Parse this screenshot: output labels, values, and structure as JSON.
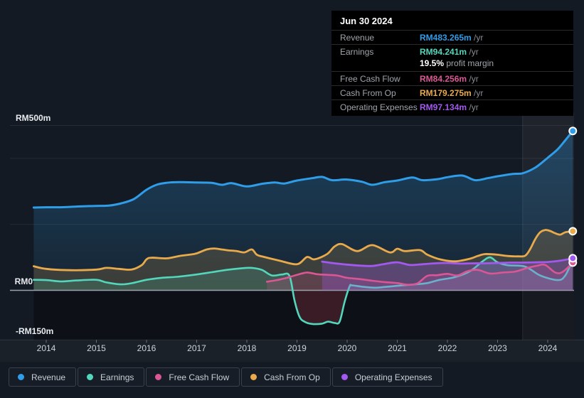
{
  "colors": {
    "background": "#141A23",
    "tooltip_background": "#000000",
    "revenue": "#2F9DE8",
    "earnings": "#52D7BC",
    "fcf": "#DB5694",
    "cashop": "#E9AA4C",
    "opex": "#A358F0",
    "negative_fill": "#D94560"
  },
  "tooltip": {
    "date": "Jun 30 2024",
    "rows": [
      {
        "key": "revenue",
        "label": "Revenue",
        "value": "RM483.265m",
        "suffix": " /yr"
      },
      {
        "key": "earnings",
        "label": "Earnings",
        "value": "RM94.241m",
        "suffix": " /yr",
        "sub_bold": "19.5%",
        "sub_text": " profit margin"
      },
      {
        "key": "fcf",
        "label": "Free Cash Flow",
        "value": "RM84.256m",
        "suffix": " /yr"
      },
      {
        "key": "cashop",
        "label": "Cash From Op",
        "value": "RM179.275m",
        "suffix": " /yr"
      },
      {
        "key": "opex",
        "label": "Operating Expenses",
        "value": "RM97.134m",
        "suffix": " /yr"
      }
    ]
  },
  "legend": {
    "items": [
      {
        "key": "revenue",
        "label": "Revenue"
      },
      {
        "key": "earnings",
        "label": "Earnings"
      },
      {
        "key": "fcf",
        "label": "Free Cash Flow"
      },
      {
        "key": "cashop",
        "label": "Cash From Op"
      },
      {
        "key": "opex",
        "label": "Operating Expenses"
      }
    ]
  },
  "chart_data": {
    "type": "area",
    "unit": "RM millions per year",
    "x_ticks": [
      2014,
      2015,
      2016,
      2017,
      2018,
      2019,
      2020,
      2021,
      2022,
      2023,
      2024
    ],
    "x_range": [
      2013.75,
      2024.5
    ],
    "y_axis": {
      "min": -150,
      "max": 500,
      "gridline_values": [
        500,
        400,
        200,
        0
      ],
      "labels": [
        {
          "text": "RM500m",
          "value": 500
        },
        {
          "text": "RM0",
          "value": 0
        },
        {
          "text": "-RM150m",
          "value": -150
        }
      ]
    },
    "highlight_band": {
      "from": 2023.5,
      "to": 2024.5
    },
    "series": [
      {
        "key": "revenue",
        "name": "Revenue",
        "points": [
          [
            2013.75,
            251
          ],
          [
            2014,
            252
          ],
          [
            2014.3,
            252
          ],
          [
            2014.6,
            254
          ],
          [
            2015,
            256
          ],
          [
            2015.25,
            257
          ],
          [
            2015.5,
            264
          ],
          [
            2015.75,
            277
          ],
          [
            2016,
            305
          ],
          [
            2016.2,
            320
          ],
          [
            2016.4,
            326
          ],
          [
            2016.65,
            328
          ],
          [
            2017,
            327
          ],
          [
            2017.3,
            326
          ],
          [
            2017.5,
            320
          ],
          [
            2017.7,
            325
          ],
          [
            2018,
            315
          ],
          [
            2018.3,
            323
          ],
          [
            2018.55,
            327
          ],
          [
            2018.75,
            324
          ],
          [
            2019,
            333
          ],
          [
            2019.3,
            340
          ],
          [
            2019.5,
            344
          ],
          [
            2019.7,
            334
          ],
          [
            2020,
            336
          ],
          [
            2020.3,
            329
          ],
          [
            2020.5,
            320
          ],
          [
            2020.75,
            328
          ],
          [
            2021,
            333
          ],
          [
            2021.3,
            342
          ],
          [
            2021.5,
            334
          ],
          [
            2021.8,
            337
          ],
          [
            2022,
            343
          ],
          [
            2022.3,
            348
          ],
          [
            2022.55,
            334
          ],
          [
            2022.8,
            340
          ],
          [
            2023,
            346
          ],
          [
            2023.3,
            353
          ],
          [
            2023.5,
            355
          ],
          [
            2023.75,
            372
          ],
          [
            2024,
            402
          ],
          [
            2024.2,
            428
          ],
          [
            2024.35,
            455
          ],
          [
            2024.5,
            483.265
          ]
        ]
      },
      {
        "key": "cashop",
        "name": "Cash From Op",
        "points": [
          [
            2013.75,
            73
          ],
          [
            2014,
            65
          ],
          [
            2014.5,
            61
          ],
          [
            2015,
            63
          ],
          [
            2015.2,
            68
          ],
          [
            2015.45,
            65
          ],
          [
            2015.7,
            63
          ],
          [
            2015.9,
            76
          ],
          [
            2016,
            94
          ],
          [
            2016.1,
            99
          ],
          [
            2016.4,
            97
          ],
          [
            2016.65,
            104
          ],
          [
            2016.85,
            108
          ],
          [
            2017,
            112
          ],
          [
            2017.2,
            124
          ],
          [
            2017.35,
            127
          ],
          [
            2017.5,
            124
          ],
          [
            2017.65,
            121
          ],
          [
            2017.8,
            119
          ],
          [
            2017.95,
            115
          ],
          [
            2018.1,
            124
          ],
          [
            2018.2,
            108
          ],
          [
            2018.35,
            101
          ],
          [
            2018.65,
            90
          ],
          [
            2019,
            79
          ],
          [
            2019.2,
            101
          ],
          [
            2019.35,
            94
          ],
          [
            2019.6,
            110
          ],
          [
            2019.75,
            133
          ],
          [
            2019.9,
            140
          ],
          [
            2020.2,
            119
          ],
          [
            2020.5,
            137
          ],
          [
            2020.85,
            115
          ],
          [
            2021,
            126
          ],
          [
            2021.15,
            119
          ],
          [
            2021.45,
            122
          ],
          [
            2021.6,
            108
          ],
          [
            2021.85,
            94
          ],
          [
            2022.15,
            88
          ],
          [
            2022.45,
            96
          ],
          [
            2022.6,
            104
          ],
          [
            2022.75,
            110
          ],
          [
            2023,
            108
          ],
          [
            2023.2,
            104
          ],
          [
            2023.4,
            103
          ],
          [
            2023.55,
            105
          ],
          [
            2023.65,
            125
          ],
          [
            2023.75,
            155
          ],
          [
            2023.85,
            176
          ],
          [
            2023.95,
            183
          ],
          [
            2024.05,
            180
          ],
          [
            2024.15,
            173
          ],
          [
            2024.25,
            169
          ],
          [
            2024.35,
            176
          ],
          [
            2024.5,
            179.275
          ]
        ]
      },
      {
        "key": "earnings",
        "name": "Earnings",
        "points": [
          [
            2013.75,
            32
          ],
          [
            2014,
            31
          ],
          [
            2014.3,
            27
          ],
          [
            2014.6,
            30
          ],
          [
            2015,
            32
          ],
          [
            2015.2,
            24
          ],
          [
            2015.5,
            18
          ],
          [
            2015.75,
            23
          ],
          [
            2016,
            32
          ],
          [
            2016.3,
            38
          ],
          [
            2016.6,
            41
          ],
          [
            2017,
            48
          ],
          [
            2017.3,
            55
          ],
          [
            2017.6,
            62
          ],
          [
            2017.9,
            67
          ],
          [
            2018.1,
            68
          ],
          [
            2018.3,
            62
          ],
          [
            2018.5,
            45
          ],
          [
            2018.7,
            48
          ],
          [
            2018.85,
            44
          ],
          [
            2018.95,
            -30
          ],
          [
            2019.05,
            -80
          ],
          [
            2019.15,
            -95
          ],
          [
            2019.3,
            -102
          ],
          [
            2019.5,
            -101
          ],
          [
            2019.62,
            -95
          ],
          [
            2019.75,
            -99
          ],
          [
            2019.85,
            -95
          ],
          [
            2019.95,
            -35
          ],
          [
            2020.05,
            12
          ],
          [
            2020.1,
            15
          ],
          [
            2020.3,
            11
          ],
          [
            2020.55,
            8
          ],
          [
            2020.8,
            11
          ],
          [
            2021.1,
            15
          ],
          [
            2021.35,
            18
          ],
          [
            2021.6,
            22
          ],
          [
            2021.85,
            32
          ],
          [
            2022.15,
            40
          ],
          [
            2022.45,
            58
          ],
          [
            2022.7,
            88
          ],
          [
            2022.85,
            100
          ],
          [
            2023,
            85
          ],
          [
            2023.2,
            76
          ],
          [
            2023.55,
            72
          ],
          [
            2023.85,
            45
          ],
          [
            2024.2,
            31
          ],
          [
            2024.35,
            45
          ],
          [
            2024.5,
            94.241
          ]
        ]
      },
      {
        "key": "fcf",
        "name": "Free Cash Flow",
        "points": [
          [
            2018.4,
            26
          ],
          [
            2018.6,
            31
          ],
          [
            2018.8,
            38
          ],
          [
            2019,
            47
          ],
          [
            2019.2,
            54
          ],
          [
            2019.4,
            49
          ],
          [
            2019.6,
            47
          ],
          [
            2019.8,
            45
          ],
          [
            2020,
            38
          ],
          [
            2020.25,
            34
          ],
          [
            2020.5,
            29
          ],
          [
            2020.75,
            25
          ],
          [
            2021,
            22
          ],
          [
            2021.2,
            17
          ],
          [
            2021.4,
            21
          ],
          [
            2021.6,
            44
          ],
          [
            2021.8,
            46
          ],
          [
            2022,
            50
          ],
          [
            2022.2,
            45
          ],
          [
            2022.4,
            58
          ],
          [
            2022.6,
            62
          ],
          [
            2022.85,
            51
          ],
          [
            2023.1,
            54
          ],
          [
            2023.35,
            57
          ],
          [
            2023.6,
            68
          ],
          [
            2023.8,
            75
          ],
          [
            2023.95,
            77
          ],
          [
            2024.15,
            54
          ],
          [
            2024.3,
            56
          ],
          [
            2024.5,
            84.256
          ]
        ]
      },
      {
        "key": "opex",
        "name": "Operating Expenses",
        "points": [
          [
            2019.5,
            87
          ],
          [
            2019.75,
            82
          ],
          [
            2020,
            78
          ],
          [
            2020.25,
            75
          ],
          [
            2020.5,
            74
          ],
          [
            2020.75,
            80
          ],
          [
            2021,
            85
          ],
          [
            2021.25,
            77
          ],
          [
            2021.5,
            79
          ],
          [
            2021.75,
            82
          ],
          [
            2022,
            83
          ],
          [
            2022.25,
            81
          ],
          [
            2022.5,
            82
          ],
          [
            2022.75,
            82
          ],
          [
            2023,
            83
          ],
          [
            2023.25,
            84
          ],
          [
            2023.5,
            84
          ],
          [
            2023.75,
            85
          ],
          [
            2024,
            86
          ],
          [
            2024.25,
            90
          ],
          [
            2024.5,
            97.134
          ]
        ]
      }
    ]
  }
}
